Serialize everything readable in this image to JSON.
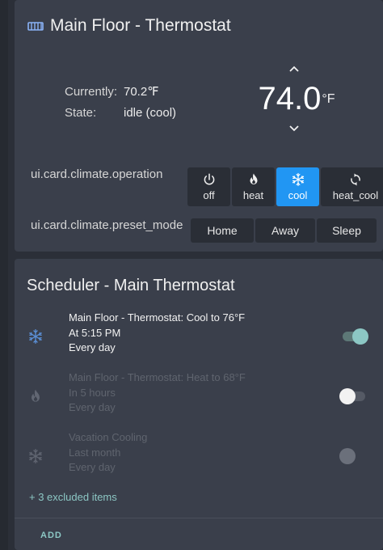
{
  "thermostat": {
    "title": "Main Floor - Thermostat",
    "current_label": "Currently:",
    "current_value": "70.2℉",
    "state_label": "State:",
    "state_value": "idle (cool)",
    "target_value": "74.0",
    "target_unit": "°F",
    "operation_label": "ui.card.climate.operation",
    "operations": [
      {
        "label": "off",
        "icon": "power-icon",
        "active": false
      },
      {
        "label": "heat",
        "icon": "fire-icon",
        "active": false
      },
      {
        "label": "cool",
        "icon": "snowflake-icon",
        "active": true
      },
      {
        "label": "heat_cool",
        "icon": "autorenew-icon",
        "active": false
      }
    ],
    "preset_label": "ui.card.climate.preset_mode",
    "presets": [
      "Home",
      "Away",
      "Sleep"
    ],
    "active_color": "#2196f3"
  },
  "scheduler": {
    "title": "Scheduler - Main Thermostat",
    "items": [
      {
        "icon": "snowflake-icon",
        "line1": "Main Floor - Thermostat: Cool to 76°F",
        "line2": "At 5:15 PM",
        "line3": "Every day",
        "toggle": "on"
      },
      {
        "icon": "fire-icon",
        "line1": "Main Floor - Thermostat: Heat to 68°F",
        "line2": "In 5 hours",
        "line3": "Every day",
        "toggle": "off"
      },
      {
        "icon": "snowflake-icon",
        "line1": "Vacation Cooling",
        "line2": "Last month",
        "line3": "Every day",
        "toggle": "disabled"
      }
    ],
    "excluded_text": "+ 3 excluded items",
    "add_label": "ADD",
    "accent_color": "#8cc7c4"
  }
}
